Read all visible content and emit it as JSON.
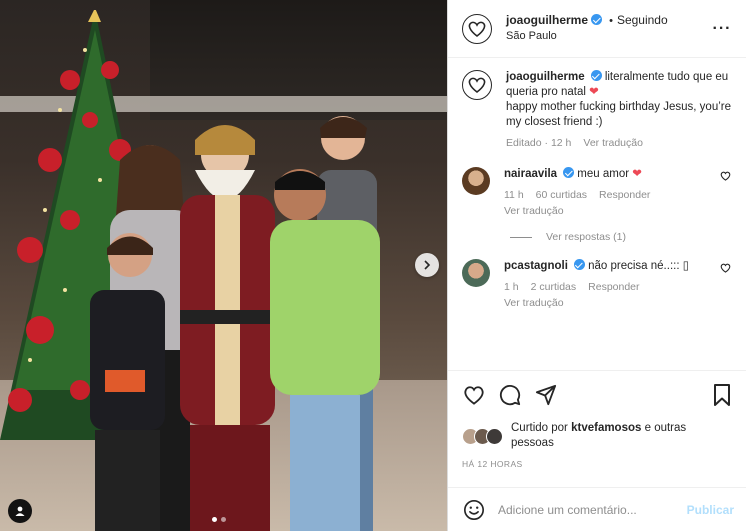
{
  "post": {
    "author": {
      "username": "joaoguilherme",
      "verified": true,
      "follow_status": "Seguindo",
      "separator": "•",
      "location": "São Paulo",
      "avatar_icon": "heart-hands-avatar-icon"
    },
    "more_options_icon": "ellipsis-icon",
    "photo": {
      "next_icon": "chevron-right-icon",
      "tags_icon": "user-tag-icon",
      "carousel": {
        "count": 2,
        "active_index": 0
      }
    }
  },
  "caption": {
    "username": "joaoguilherme",
    "line1": "literalmente tudo que eu queria pro natal",
    "line2": "happy mother fucking birthday Jesus, you’re my closest friend :)",
    "heart": "❤",
    "meta": {
      "edited": "Editado · 12 h",
      "translate": "Ver tradução"
    }
  },
  "comments": [
    {
      "username": "nairaavila",
      "text": "meu amor",
      "emoji": "❤",
      "time": "11 h",
      "likes": "60 curtidas",
      "reply": "Responder",
      "translate": "Ver tradução",
      "view_replies": "Ver respostas (1)"
    },
    {
      "username": "pcastagnoli",
      "text": "não precisa né..::: ",
      "trailing_glyph": "▯",
      "time": "1 h",
      "likes": "2 curtidas",
      "reply": "Responder",
      "translate": "Ver tradução"
    }
  ],
  "actions": {
    "like_icon": "heart-outline-icon",
    "comment_icon": "comment-icon",
    "share_icon": "paper-plane-icon",
    "save_icon": "bookmark-icon"
  },
  "likes": {
    "text_prefix": "Curtido por ",
    "user": "ktvefamosos",
    "text_suffix": " e outras pessoas",
    "avatar_colors": [
      "#b8a08c",
      "#6b5a4d",
      "#3e3a38"
    ]
  },
  "timestamp": "HÁ 12 HORAS",
  "comment_box": {
    "emoji_icon": "smiley-icon",
    "placeholder": "Adicione um comentário...",
    "publish_label": "Publicar"
  },
  "colors": {
    "verified": "#3897f0",
    "heart": "#ed4956",
    "publish_disabled": "#b2dffc",
    "muted_text": "#8e8e8e"
  }
}
